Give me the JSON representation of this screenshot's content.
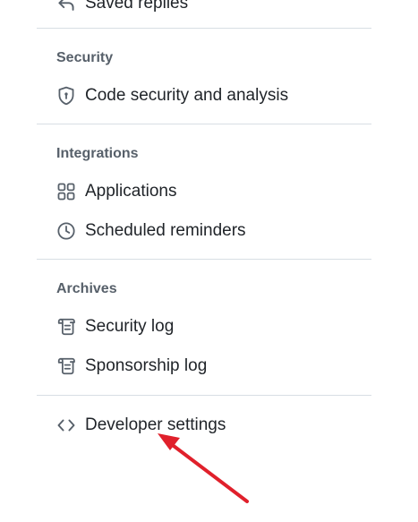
{
  "top_item": {
    "label": "Saved replies",
    "icon": "reply-icon"
  },
  "sections": [
    {
      "title": "Security",
      "items": [
        {
          "label": "Code security and analysis",
          "icon": "shield-icon"
        }
      ]
    },
    {
      "title": "Integrations",
      "items": [
        {
          "label": "Applications",
          "icon": "apps-grid-icon"
        },
        {
          "label": "Scheduled reminders",
          "icon": "clock-icon"
        }
      ]
    },
    {
      "title": "Archives",
      "items": [
        {
          "label": "Security log",
          "icon": "log-icon"
        },
        {
          "label": "Sponsorship log",
          "icon": "log-icon"
        }
      ]
    }
  ],
  "developer_settings": {
    "label": "Developer settings",
    "icon": "code-icon"
  },
  "colors": {
    "text": "#1f2328",
    "muted": "#57606a",
    "divider": "#d8dee4",
    "annotation_arrow": "#e0202b"
  }
}
